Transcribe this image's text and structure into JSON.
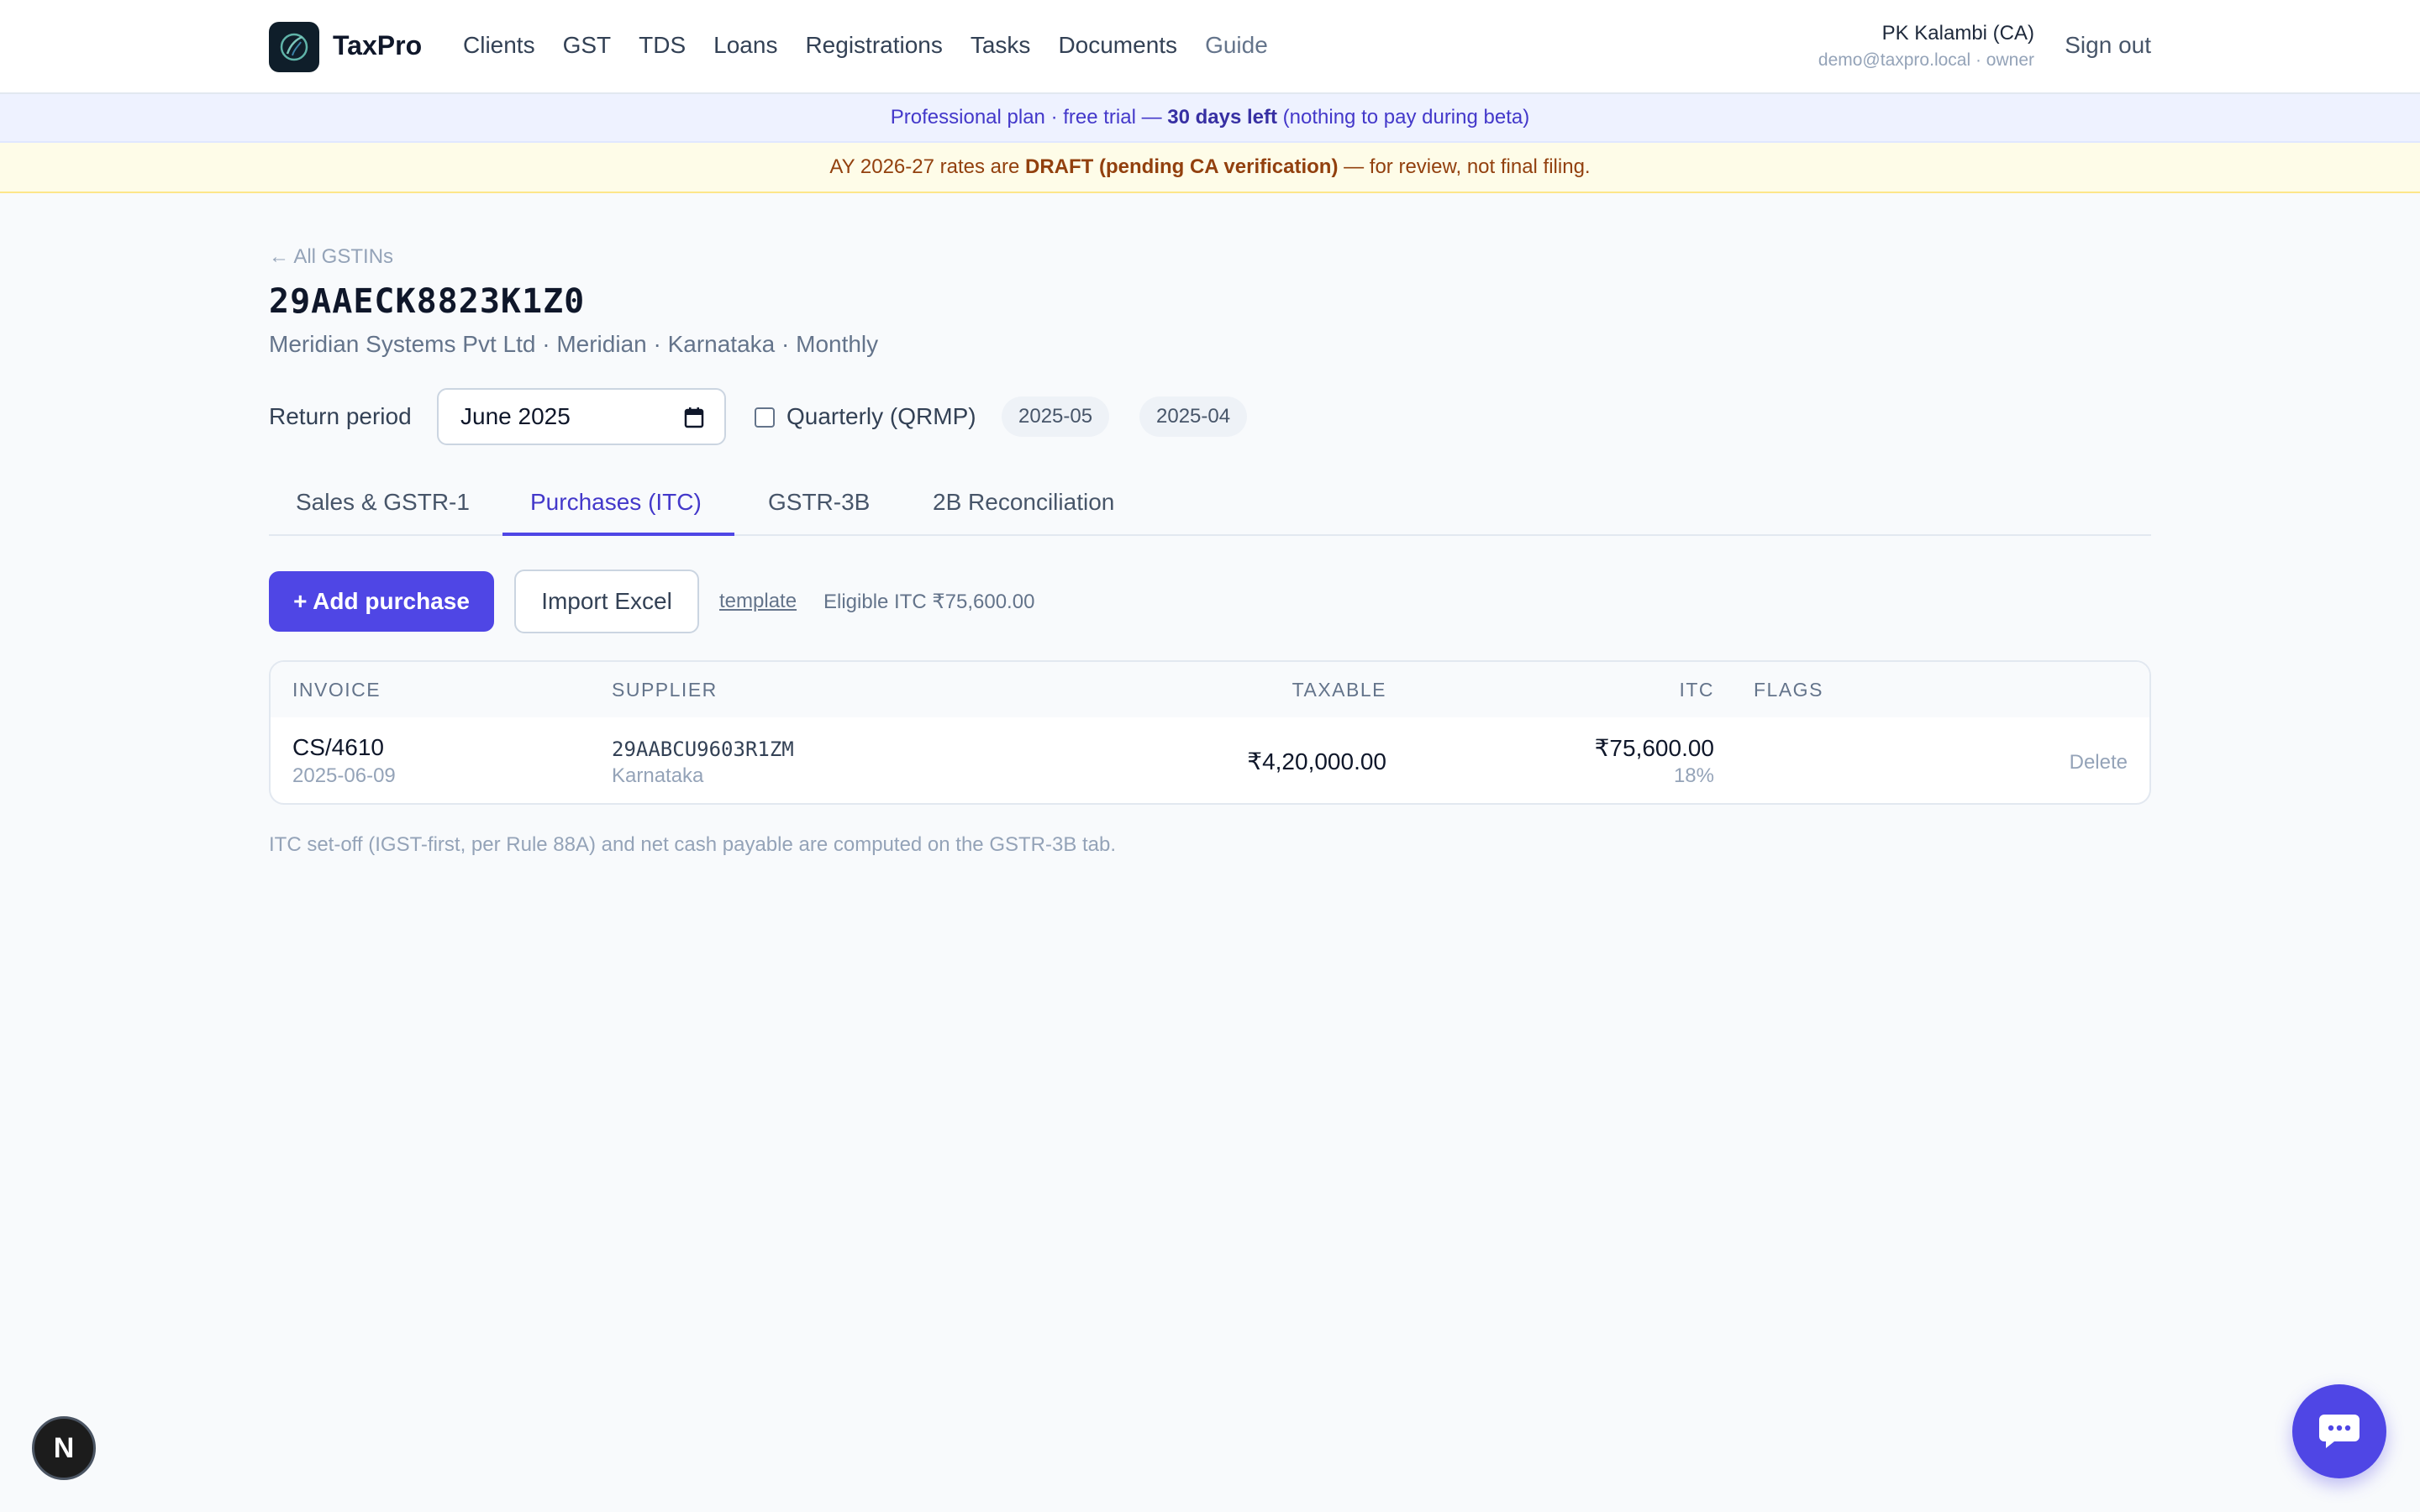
{
  "app": {
    "brand": "TaxPro"
  },
  "nav": {
    "items": [
      "Clients",
      "GST",
      "TDS",
      "Loans",
      "Registrations",
      "Tasks",
      "Documents",
      "Guide"
    ]
  },
  "user": {
    "name": "PK Kalambi (CA)",
    "meta": "demo@taxpro.local · owner",
    "signout": "Sign out"
  },
  "banners": {
    "plan_prefix": "Professional plan · free trial — ",
    "plan_bold": "30 days left",
    "plan_suffix": " (nothing to pay during beta)",
    "draft_prefix": "AY 2026-27 rates are ",
    "draft_bold": "DRAFT (pending CA verification)",
    "draft_suffix": " — for review, not final filing."
  },
  "page": {
    "back": "← All GSTINs",
    "gstin": "29AAECK8823K1Z0",
    "subtitle": "Meridian Systems Pvt Ltd · Meridian · Karnataka · Monthly"
  },
  "period": {
    "label": "Return period",
    "value": "June 2025",
    "qrmp_label": "Quarterly (QRMP)",
    "qrmp_checked": false,
    "chips": [
      "2025-05",
      "2025-04"
    ]
  },
  "tabs": [
    {
      "label": "Sales & GSTR-1",
      "active": false
    },
    {
      "label": "Purchases (ITC)",
      "active": true
    },
    {
      "label": "GSTR-3B",
      "active": false
    },
    {
      "label": "2B Reconciliation",
      "active": false
    }
  ],
  "actions": {
    "add": "+ Add purchase",
    "import": "Import Excel",
    "template": "template",
    "eligible": "Eligible ITC ₹75,600.00"
  },
  "table": {
    "headers": {
      "invoice": "INVOICE",
      "supplier": "SUPPLIER",
      "taxable": "TAXABLE",
      "itc": "ITC",
      "flags": "FLAGS"
    },
    "rows": [
      {
        "invoice": "CS/4610",
        "date": "2025-06-09",
        "supplier_gstin": "29AABCU9603R1ZM",
        "supplier_state": "Karnataka",
        "taxable": "₹4,20,000.00",
        "itc": "₹75,600.00",
        "rate": "18%",
        "flags": "",
        "delete": "Delete"
      }
    ]
  },
  "footnote": "ITC set-off (IGST-first, per Rule 88A) and net cash payable are computed on the GSTR-3B tab.",
  "floating": {
    "dev_badge": "N"
  },
  "colors": {
    "accent": "#4f46e5",
    "draft_bg": "#fefce8",
    "plan_bg": "#eef2ff"
  }
}
